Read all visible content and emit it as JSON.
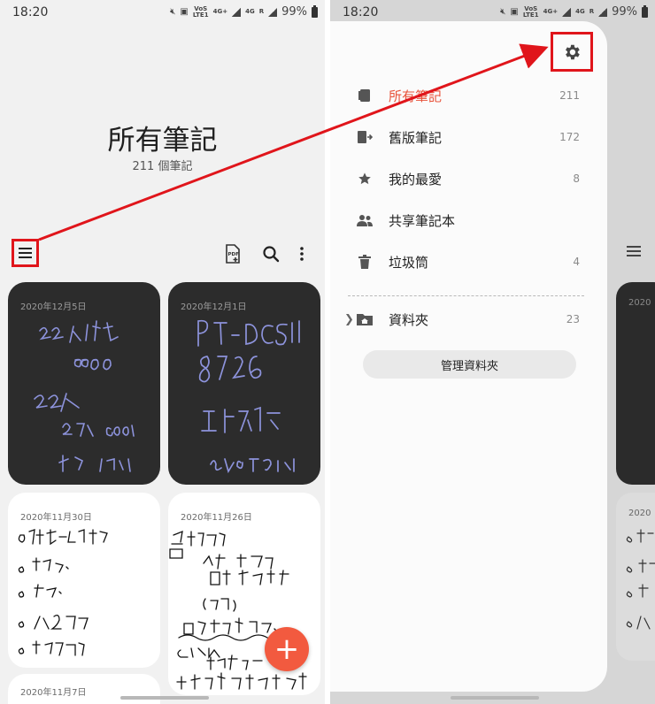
{
  "status_bar": {
    "time": "18:20",
    "battery": "99%",
    "lte_top": "VoS",
    "lte_bottom": "LTE1",
    "net_4g_plus": "4G+",
    "net_4g": "4G",
    "roam": "R"
  },
  "notes_page": {
    "title": "所有筆記",
    "subtitle": "211 個筆記",
    "cards": [
      {
        "date": "2020年12月5日"
      },
      {
        "date": "2020年12月1日"
      },
      {
        "date": "2020年11月30日"
      },
      {
        "date": "2020年11月26日"
      },
      {
        "date": "2020年11月7日"
      }
    ],
    "fab_symbol": "+"
  },
  "drawer": {
    "items": [
      {
        "label": "所有筆記",
        "count": "211",
        "icon": "notes-stack-icon"
      },
      {
        "label": "舊版筆記",
        "count": "172",
        "icon": "old-notes-icon"
      },
      {
        "label": "我的最愛",
        "count": "8",
        "icon": "star-icon"
      },
      {
        "label": "共享筆記本",
        "count": "",
        "icon": "people-icon"
      },
      {
        "label": "垃圾筒",
        "count": "4",
        "icon": "trash-icon"
      }
    ],
    "folder": {
      "label": "資料夾",
      "count": "23"
    },
    "manage_button": "管理資料夾",
    "peek_cards": [
      {
        "date": "2020"
      },
      {
        "date": "2020"
      }
    ]
  },
  "colors": {
    "accent": "#e8543c",
    "fab": "#f25a3f",
    "annotation_red": "#e0151b",
    "handwriting_ink": "#8d93dc",
    "dark_card": "#2c2c2c"
  }
}
